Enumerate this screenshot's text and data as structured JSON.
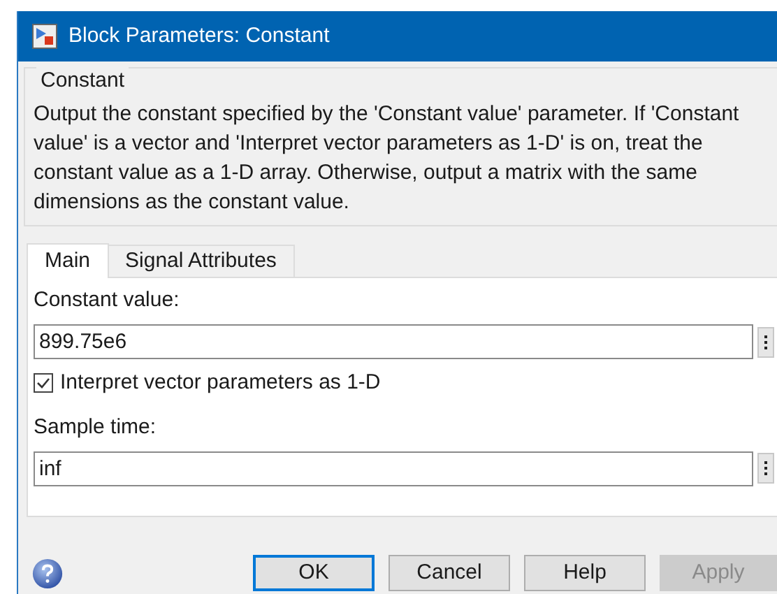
{
  "window": {
    "title": "Block Parameters: Constant"
  },
  "group": {
    "title": "Constant",
    "description": "Output the constant specified by the 'Constant value' parameter. If 'Constant value' is a vector and 'Interpret vector parameters as 1-D' is on, treat the constant value as a 1-D array. Otherwise, output a matrix with the same dimensions as the constant value."
  },
  "tabs": [
    {
      "label": "Main",
      "selected": true
    },
    {
      "label": "Signal Attributes",
      "selected": false
    }
  ],
  "parameters": [
    {
      "kind": "field",
      "label": "Constant value:",
      "value": "899.75e6"
    },
    {
      "kind": "checkbox",
      "label": "Interpret vector parameters as 1-D",
      "checked": true
    },
    {
      "kind": "field",
      "label": "Sample time:",
      "value": "inf"
    }
  ],
  "buttons": [
    {
      "label": "OK",
      "focused": true,
      "disabled": false
    },
    {
      "label": "Cancel",
      "focused": false,
      "disabled": false
    },
    {
      "label": "Help",
      "focused": false,
      "disabled": false
    },
    {
      "label": "Apply",
      "focused": false,
      "disabled": true
    }
  ]
}
